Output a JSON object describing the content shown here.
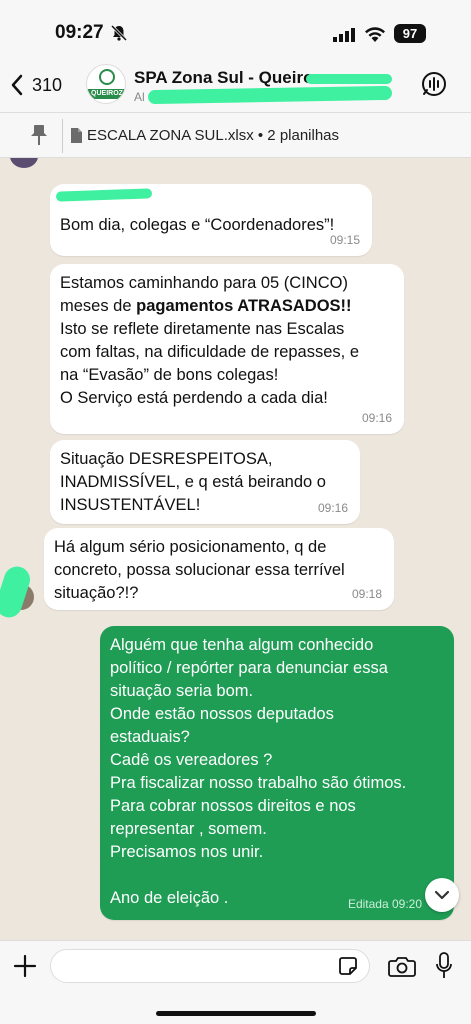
{
  "status_bar": {
    "time": "09:27",
    "battery": "97"
  },
  "header": {
    "back_count": "310",
    "title": "SPA Zona Sul - Queiroz",
    "subtitle": "Al",
    "avatar_text": "QUEIROZ"
  },
  "pinned": {
    "text": "ESCALA ZONA SUL.xlsx • 2 planilhas"
  },
  "messages": [
    {
      "text": "Bom dia, colegas e “Coordenadores”!",
      "time": "09:15",
      "direction": "in"
    },
    {
      "text_before": "Estamos caminhando para 05 (CINCO)\nmeses de ",
      "text_bold": "pagamentos ATRASADOS!!",
      "text_after": "\nIsto se reflete diretamente nas Escalas\ncom faltas, na dificuldade de repasses, e\nna “Evasão” de bons colegas!\nO Serviço está perdendo a cada dia!",
      "time": "09:16",
      "direction": "in"
    },
    {
      "text": "Situação DESRESPEITOSA,\nINADMISSÍVEL, e q está beirando o\nINSUSTENTÁVEL!",
      "time": "09:16",
      "direction": "in"
    },
    {
      "text": "Há algum sério posicionamento, q de\nconcreto, possa solucionar essa terrível\nsituação?!?",
      "time": "09:18",
      "direction": "in"
    },
    {
      "text": "Alguém que tenha algum conhecido\npolítico / repórter para denunciar essa\nsituação seria bom.\nOnde estão nossos deputados\nestaduais?\nCadê os vereadores ?\nPra fiscalizar nosso trabalho são ótimos.\nPara cobrar nossos direitos e nos\nrepresentar , somem.\nPrecisamos nos unir.\n\nAno de eleição .",
      "time": "Editada 09:20",
      "direction": "out"
    }
  ],
  "input": {
    "placeholder": ""
  },
  "colors": {
    "outgoing_bubble": "#1f9d55",
    "incoming_bubble": "#ffffff",
    "chat_background": "#ece6dc",
    "redaction": "#3ef0a0"
  },
  "icons": [
    "bell-off-icon",
    "signal-icon",
    "wifi-icon",
    "chevron-left-icon",
    "voice-call-icon",
    "pin-icon",
    "document-icon",
    "chevron-down-icon",
    "plus-icon",
    "sticker-icon",
    "camera-icon",
    "microphone-icon"
  ]
}
